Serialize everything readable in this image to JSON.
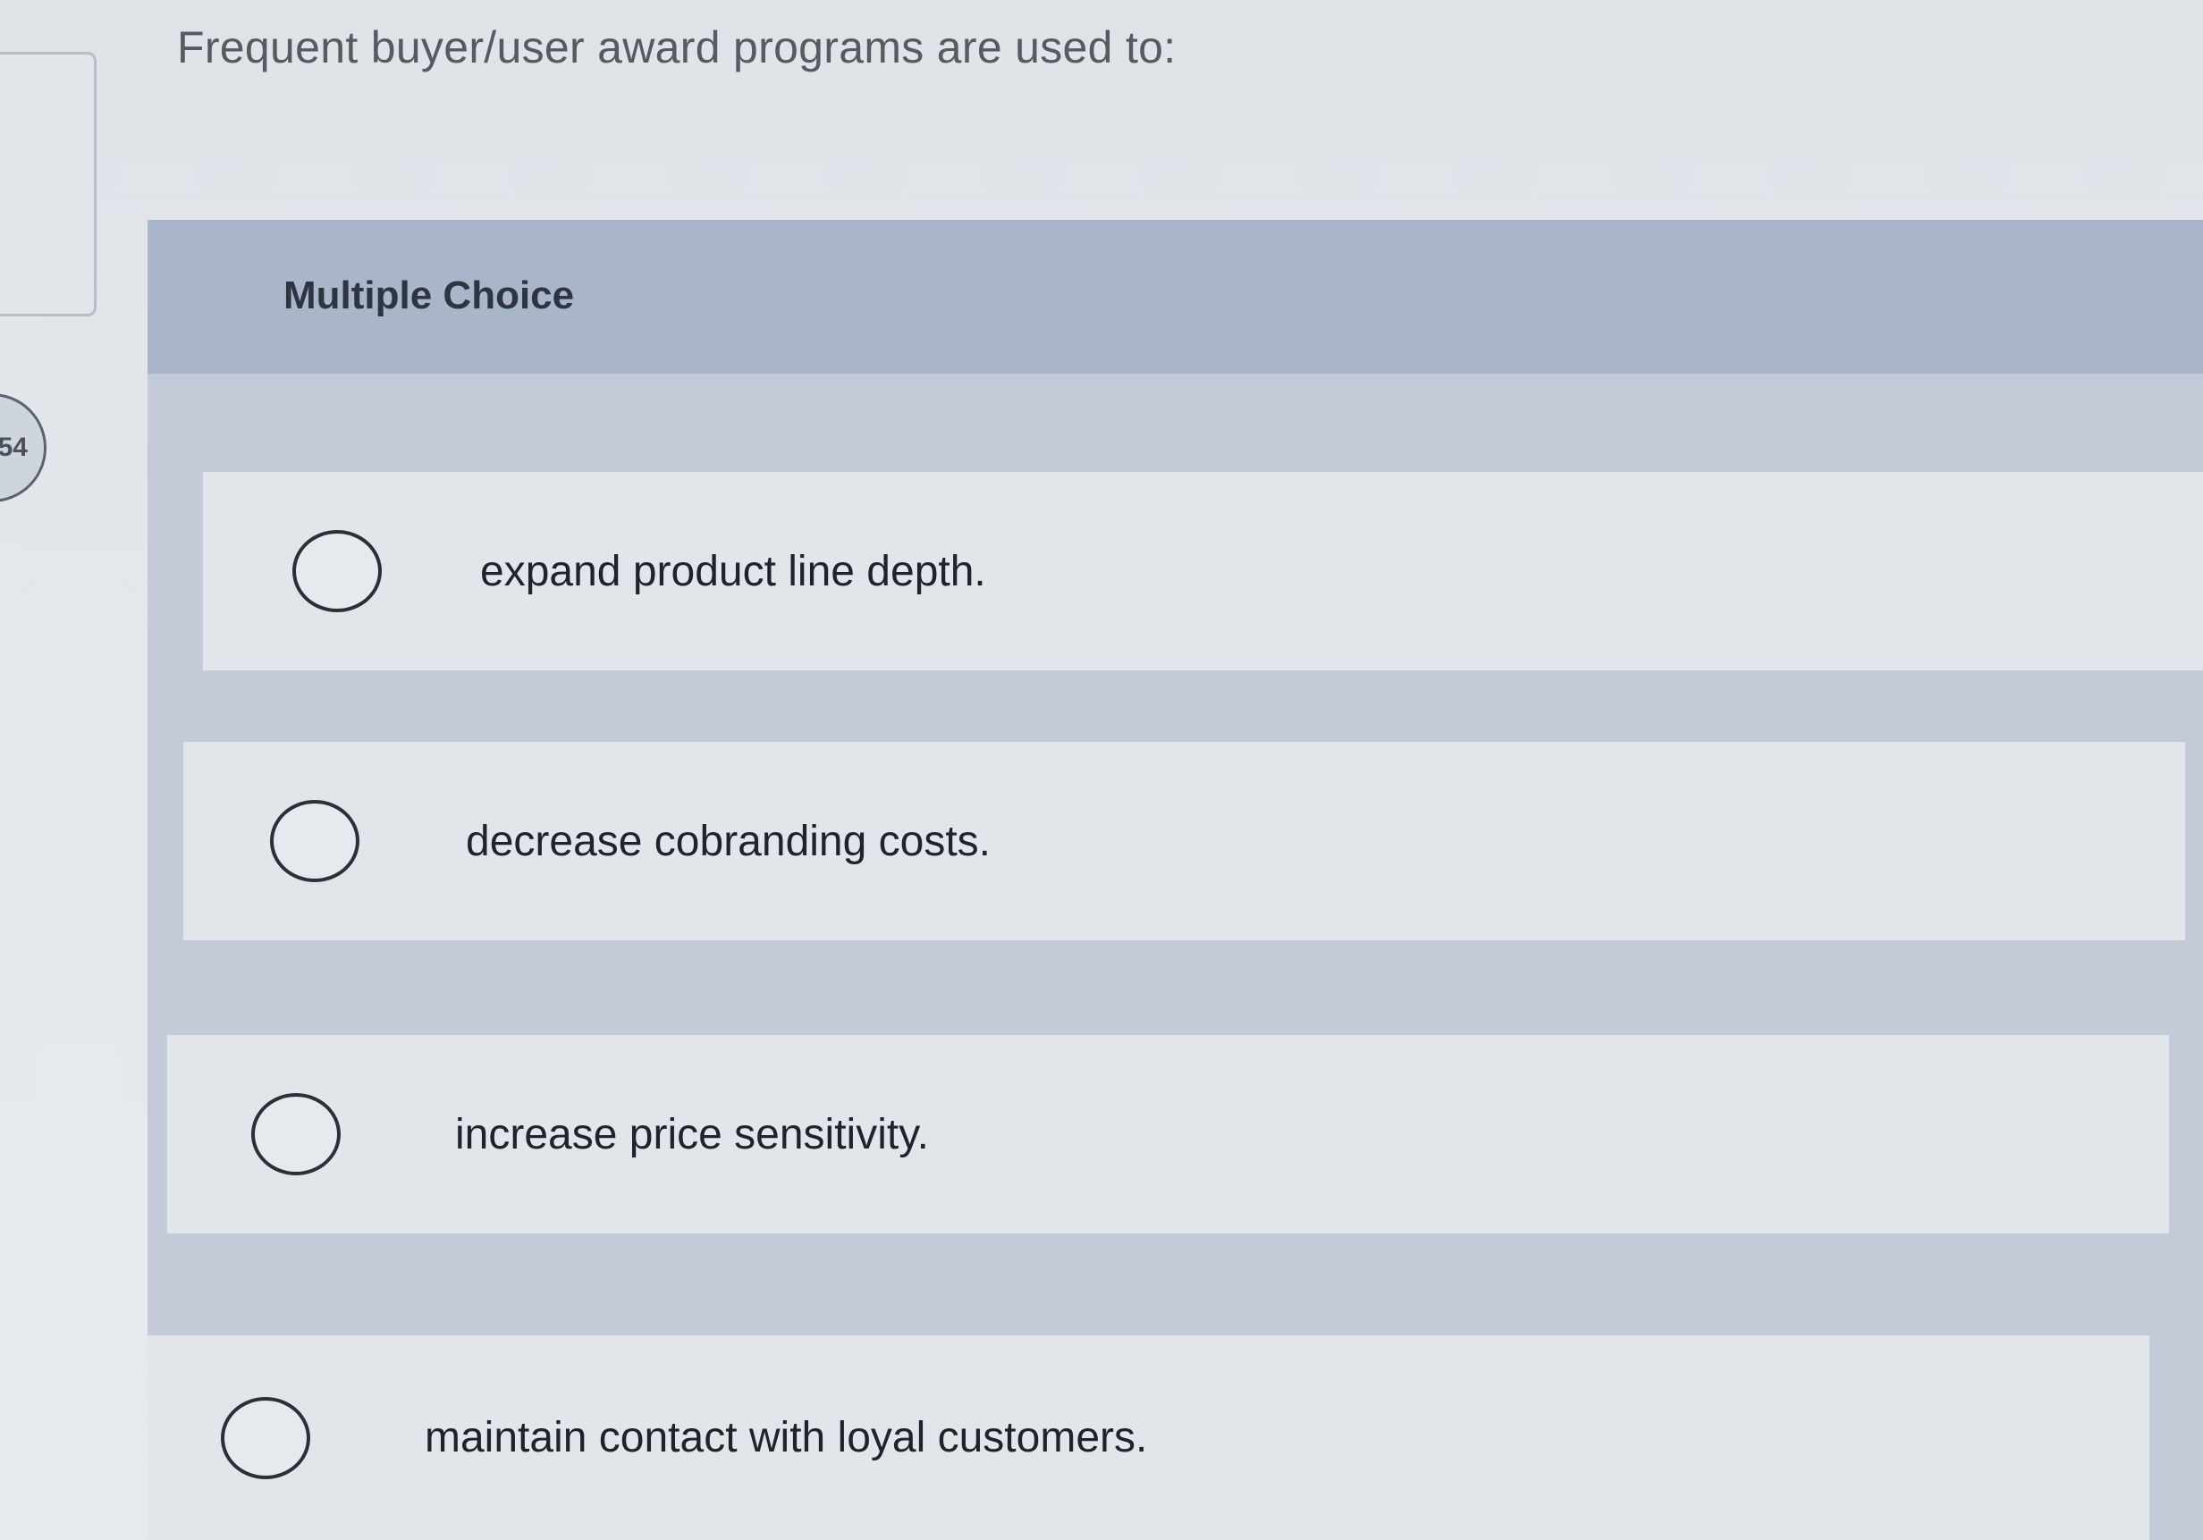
{
  "question": {
    "number": "54",
    "text": "Frequent buyer/user award programs are used to:"
  },
  "question_type": "Multiple Choice",
  "choices": [
    {
      "label": "expand product line depth.",
      "selected": false
    },
    {
      "label": "decrease cobranding costs.",
      "selected": false
    },
    {
      "label": "increase price sensitivity.",
      "selected": false
    },
    {
      "label": "maintain contact with loyal customers.",
      "selected": false
    }
  ],
  "colors": {
    "header_bar": "#a9b6c9",
    "choice_background": "#e2e6eb",
    "page_background": "#dfe3e8"
  }
}
